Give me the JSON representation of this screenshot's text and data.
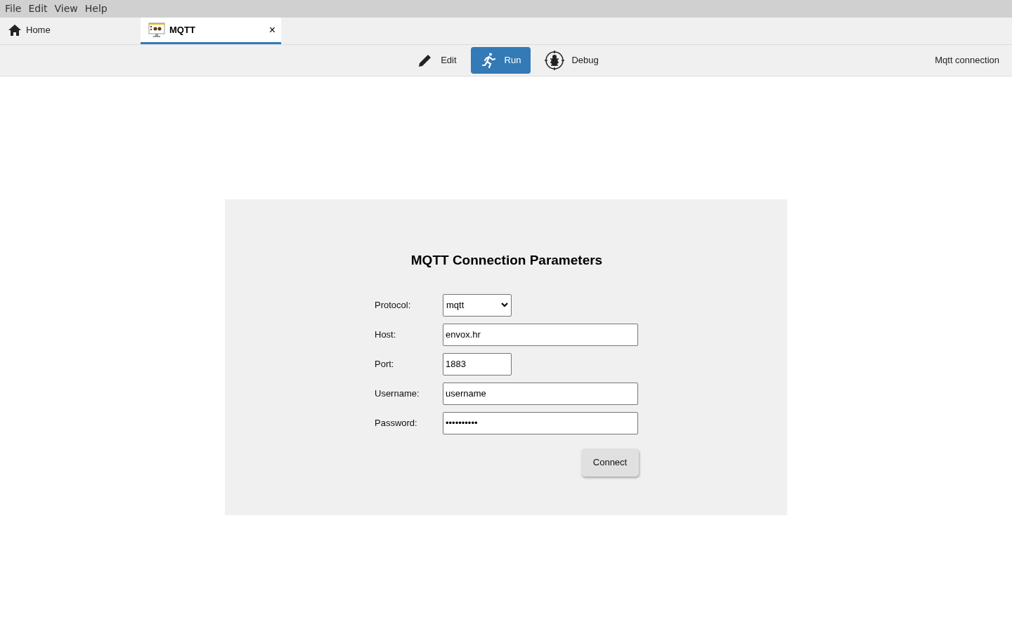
{
  "menu": [
    "File",
    "Edit",
    "View",
    "Help"
  ],
  "tabs": [
    {
      "label": "Home",
      "kind": "home",
      "selected": false
    },
    {
      "label": "MQTT",
      "kind": "project",
      "selected": true
    }
  ],
  "tab_close": "×",
  "modes": [
    {
      "label": "Edit",
      "kind": "edit",
      "selected": false
    },
    {
      "label": "Run",
      "kind": "run",
      "selected": true
    },
    {
      "label": "Debug",
      "kind": "debug",
      "selected": false
    }
  ],
  "page_title": "Mqtt connection",
  "form": {
    "title": "MQTT Connection Parameters",
    "fields": [
      {
        "label": "Protocol:",
        "kind": "select",
        "value": "mqtt"
      },
      {
        "label": "Host:",
        "kind": "text",
        "value": "envox.hr"
      },
      {
        "label": "Port:",
        "kind": "short",
        "value": "1883"
      },
      {
        "label": "Username:",
        "kind": "text",
        "value": "username"
      },
      {
        "label": "Password:",
        "kind": "text",
        "value": "••••••••••"
      }
    ],
    "button": "Connect"
  }
}
